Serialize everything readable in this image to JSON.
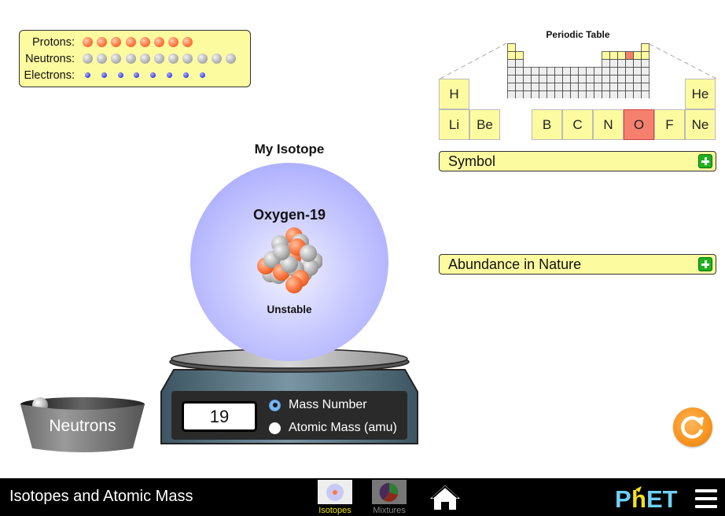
{
  "counts": {
    "protons_label": "Protons:",
    "neutrons_label": "Neutrons:",
    "electrons_label": "Electrons:",
    "protons": 8,
    "neutrons": 11,
    "electrons": 8
  },
  "periodic_table": {
    "title": "Periodic Table",
    "selected": "O",
    "elements": [
      {
        "symbol": "H"
      },
      {
        "symbol": "He"
      },
      {
        "symbol": "Li"
      },
      {
        "symbol": "Be"
      },
      {
        "symbol": "B"
      },
      {
        "symbol": "C"
      },
      {
        "symbol": "N"
      },
      {
        "symbol": "O"
      },
      {
        "symbol": "F"
      },
      {
        "symbol": "Ne"
      }
    ]
  },
  "accordions": {
    "symbol": "Symbol",
    "abundance": "Abundance in Nature"
  },
  "isotope": {
    "title": "My Isotope",
    "name": "Oxygen-19",
    "stability": "Unstable"
  },
  "scale": {
    "value": "19",
    "options": [
      {
        "label": "Mass Number",
        "selected": true
      },
      {
        "label": "Atomic Mass (amu)",
        "selected": false
      }
    ]
  },
  "bucket": {
    "label": "Neutrons"
  },
  "navbar": {
    "title": "Isotopes and Atomic Mass",
    "screens": [
      {
        "label": "Isotopes",
        "active": true,
        "color": "#f0e000"
      },
      {
        "label": "Mixtures",
        "active": false,
        "color": "#888888"
      }
    ],
    "logo": "PhET"
  },
  "colors": {
    "panel_yellow": "#fdfba0",
    "selected_element": "#f5806e",
    "proton": "#ff7a45",
    "neutron": "#b6b6b6",
    "electron": "#3a3ae8",
    "reset_orange": "#f7941d",
    "plus_green": "#1fb11f"
  }
}
